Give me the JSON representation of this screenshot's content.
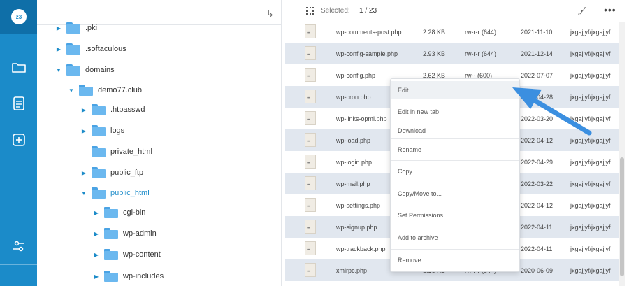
{
  "rail": {
    "logo_text": "z3",
    "icons": [
      "folder-icon",
      "document-icon",
      "add-square-icon",
      "settings-sliders-icon"
    ],
    "colors": {
      "bg": "#1b8bc9",
      "logo_bg": "#0f6fa8"
    }
  },
  "tree": {
    "nodes": [
      {
        "label": ".pki",
        "expanded": false
      },
      {
        "label": ".softaculous",
        "expanded": false
      },
      {
        "label": "domains",
        "expanded": true
      },
      {
        "label": "demo77.club",
        "expanded": true
      },
      {
        "label": ".htpasswd",
        "expanded": false
      },
      {
        "label": "logs",
        "expanded": false
      },
      {
        "label": "private_html",
        "expanded": false
      },
      {
        "label": "public_ftp",
        "expanded": false
      },
      {
        "label": "public_html",
        "expanded": true,
        "active": true
      },
      {
        "label": "cgi-bin",
        "expanded": false
      },
      {
        "label": "wp-admin",
        "expanded": false
      },
      {
        "label": "wp-content",
        "expanded": false
      },
      {
        "label": "wp-includes",
        "expanded": false
      }
    ]
  },
  "toolbar": {
    "selected_label": "Selected:",
    "selected_count": "1 / 23"
  },
  "files": [
    {
      "name": "wp-comments-post.php",
      "size": "2.28 KB",
      "perm": "rw-r-r (644)",
      "date": "2021-11-10",
      "owner": "jxgajjyf/jxgajjyf"
    },
    {
      "name": "wp-config-sample.php",
      "size": "2.93 KB",
      "perm": "rw-r-r (644)",
      "date": "2021-12-14",
      "owner": "jxgajjyf/jxgajjyf"
    },
    {
      "name": "wp-config.php",
      "size": "2.62 KB",
      "perm": "rw-- (600)",
      "date": "2022-07-07",
      "owner": "jxgajjyf/jxgajjyf"
    },
    {
      "name": "wp-cron.php",
      "size": "",
      "perm": "",
      "date": "2022-04-28",
      "owner": "jxgajjyf/jxgajjyf"
    },
    {
      "name": "wp-links-opml.php",
      "size": "",
      "perm": "",
      "date": "2022-03-20",
      "owner": "jxgajjyf/jxgajjyf"
    },
    {
      "name": "wp-load.php",
      "size": "",
      "perm": "",
      "date": "2022-04-12",
      "owner": "jxgajjyf/jxgajjyf"
    },
    {
      "name": "wp-login.php",
      "size": "",
      "perm": "",
      "date": "2022-04-29",
      "owner": "jxgajjyf/jxgajjyf"
    },
    {
      "name": "wp-mail.php",
      "size": "",
      "perm": "",
      "date": "2022-03-22",
      "owner": "jxgajjyf/jxgajjyf"
    },
    {
      "name": "wp-settings.php",
      "size": "",
      "perm": "",
      "date": "2022-04-12",
      "owner": "jxgajjyf/jxgajjyf"
    },
    {
      "name": "wp-signup.php",
      "size": "",
      "perm": "",
      "date": "2022-04-11",
      "owner": "jxgajjyf/jxgajjyf"
    },
    {
      "name": "wp-trackback.php",
      "size": "",
      "perm": "",
      "date": "2022-04-11",
      "owner": "jxgajjyf/jxgajjyf"
    },
    {
      "name": "xmlrpc.php",
      "size": "3.16 KB",
      "perm": "rw-r-r (644)",
      "date": "2020-06-09",
      "owner": "jxgajjyf/jxgajjyf"
    }
  ],
  "context_menu": {
    "items": [
      {
        "label": "Edit",
        "name": "menu-edit"
      },
      {
        "label": "Edit in new tab",
        "name": "menu-edit-new-tab"
      },
      {
        "label": "Download",
        "name": "menu-download"
      },
      {
        "label": "Rename",
        "name": "menu-rename"
      },
      {
        "label": "Copy",
        "name": "menu-copy"
      },
      {
        "label": "Copy/Move to...",
        "name": "menu-copy-move"
      },
      {
        "label": "Set Permissions",
        "name": "menu-set-permissions"
      },
      {
        "label": "Add to archive",
        "name": "menu-add-archive"
      },
      {
        "label": "Remove",
        "name": "menu-remove"
      }
    ]
  },
  "annotation": {
    "arrow_color": "#3b8fe0"
  }
}
